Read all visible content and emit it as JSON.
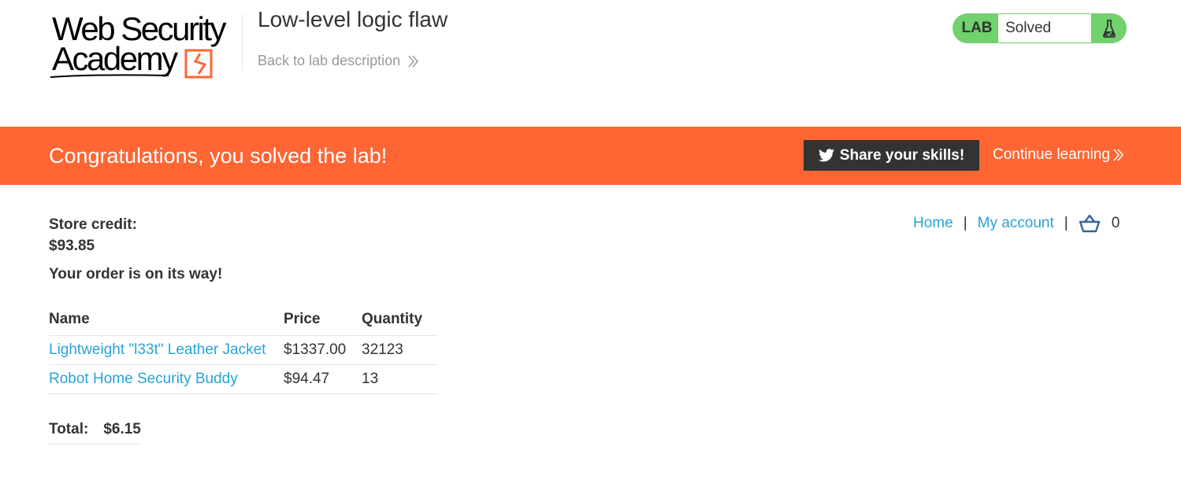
{
  "header": {
    "logo_line1": "Web Security",
    "logo_line2": "Academy",
    "lab_title": "Low-level logic flaw",
    "back_link": "Back to lab description",
    "lab_badge_label": "LAB",
    "lab_status": "Solved"
  },
  "banner": {
    "message": "Congratulations, you solved the lab!",
    "share_button": "Share your skills!",
    "continue_link": "Continue learning"
  },
  "account": {
    "store_credit_label": "Store credit:",
    "store_credit_value": "$93.85",
    "order_message": "Your order is on its way!"
  },
  "nav": {
    "home": "Home",
    "separator": "|",
    "my_account": "My account",
    "cart_count": "0"
  },
  "order_table": {
    "headers": [
      "Name",
      "Price",
      "Quantity"
    ],
    "rows": [
      {
        "name": "Lightweight \"l33t\" Leather Jacket",
        "price": "$1337.00",
        "quantity": "32123"
      },
      {
        "name": "Robot Home Security Buddy",
        "price": "$94.47",
        "quantity": "13"
      }
    ]
  },
  "total": {
    "label": "Total:",
    "value": "$6.15"
  },
  "colors": {
    "accent_orange": "#ff6633",
    "link_blue": "#29a3d7",
    "lab_green": "#70d16d",
    "dark": "#333332"
  }
}
